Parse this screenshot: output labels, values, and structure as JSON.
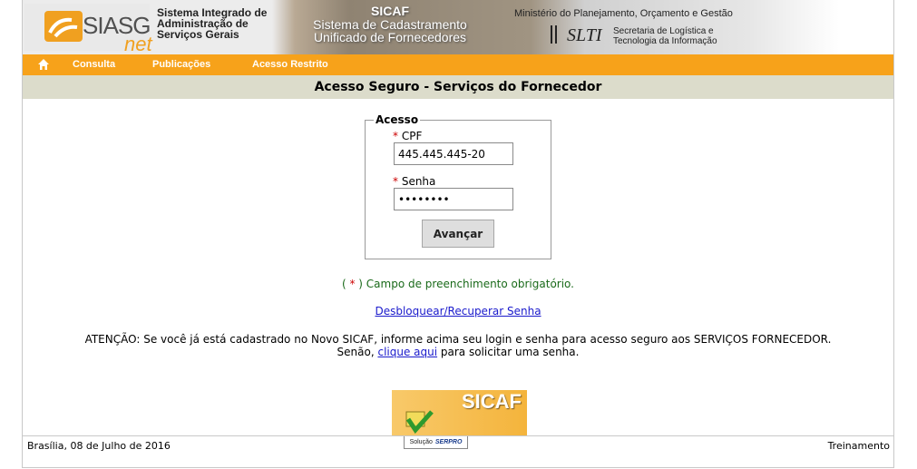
{
  "header": {
    "logo_main": "SIASG",
    "logo_sub": "net",
    "system_name_lines": [
      "Sistema Integrado de",
      "Administração de",
      "Serviços Gerais"
    ],
    "sicaf_title": "SICAF",
    "sicaf_subtitle_lines": [
      "Sistema de Cadastramento",
      "Unificado de Fornecedores"
    ],
    "ministry": "Ministério do Planejamento, Orçamento e Gestão",
    "slti": "SLTI",
    "slti_desc_lines": [
      "Secretaria de Logística e",
      "Tecnologia da Informação"
    ]
  },
  "nav": {
    "home_icon": "home-icon",
    "items": [
      {
        "label": "Consulta"
      },
      {
        "label": "Publicações"
      },
      {
        "label": "Acesso Restrito"
      }
    ]
  },
  "page": {
    "title": "Acesso Seguro - Serviços do Fornecedor"
  },
  "login": {
    "legend": "Acesso",
    "required_mark": "*",
    "cpf_label": "CPF",
    "cpf_value": "445.445.445-20",
    "password_label": "Senha",
    "password_value": "••••••••",
    "submit_label": "Avançar"
  },
  "notes": {
    "required_note_prefix": "( ",
    "required_note_mark": "*",
    "required_note_suffix": " ) Campo de preenchimento obrigatório.",
    "recover_link": "Desbloquear/Recuperar Senha",
    "warning_line1": "ATENÇÃO: Se você já está cadastrado no Novo SICAF, informe acima seu login e senha para acesso seguro aos SERVIÇOS FORNECEDOR.",
    "warning_line2_prefix": "Senão, ",
    "warning_link": "clique aqui",
    "warning_line2_suffix": " para solicitar uma senha."
  },
  "badge": {
    "text": "SICAF"
  },
  "footer": {
    "date": "Brasília, 08 de Julho de 2016",
    "serpro_label": "Solução",
    "serpro_brand": "SERPRO",
    "environment": "Treinamento"
  },
  "colors": {
    "nav_bg": "#f7a21a",
    "title_band_bg": "#dcdccb",
    "required": "#cc0000",
    "note_green": "#1a6a1a",
    "link_blue": "#1a1acc"
  }
}
